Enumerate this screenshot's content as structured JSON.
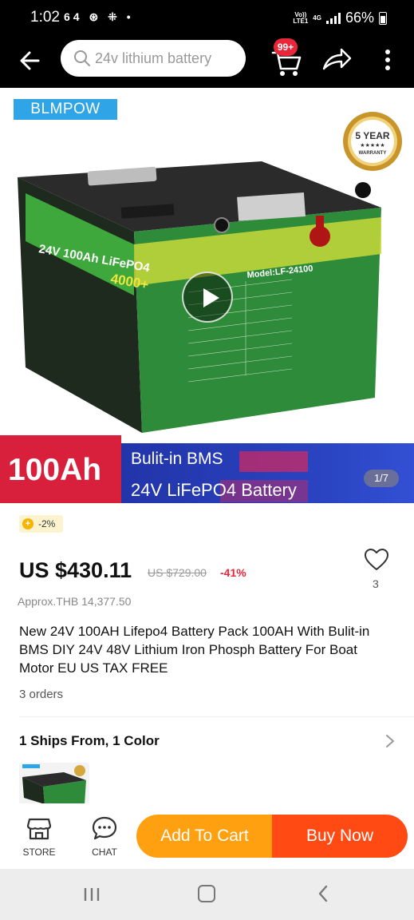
{
  "status_bar": {
    "time": "1:02",
    "left_icons": "64 ⊛ ⁜ •",
    "net_top": "Vo))",
    "net_bottom": "LTE1",
    "net_4g": "4G",
    "battery": "66%"
  },
  "search": {
    "placeholder": "24v lithium battery",
    "cart_badge": "99+"
  },
  "gallery": {
    "brand": "BLMPOW",
    "banner_capacity": "100Ah",
    "banner_line1": "Bulit-in BMS",
    "banner_line2": "24V LiFePO4 Battery",
    "pager": "1/7",
    "warranty_top": "5 YEAR",
    "warranty_bottom": "WARRANTY",
    "battery_label": "24V 100Ah LiFePO4",
    "battery_cycles": "4000+",
    "battery_model": "Model:LF-24100"
  },
  "product": {
    "discount_chip": "-2%",
    "price": "US $430.11",
    "original_price": "US $729.00",
    "discount_pct": "-41%",
    "wish_count": "3",
    "approx": "Approx.THB 14,377.50",
    "title": "New 24V 100AH Lifepo4 Battery Pack 100AH With Bulit-in BMS DIY 24V 48V Lithium Iron Phosph Battery For Boat Motor EU US TAX FREE",
    "orders": "3 orders",
    "ships": "1 Ships From, 1 Color"
  },
  "action_bar": {
    "store": "STORE",
    "chat": "CHAT",
    "add_to_cart": "Add To Cart",
    "buy_now": "Buy Now"
  },
  "colors": {
    "accent_orange": "#ffa011",
    "buy_red": "#ff4a14",
    "price_red": "#e8283a",
    "brand_blue": "#2fa4e7"
  }
}
